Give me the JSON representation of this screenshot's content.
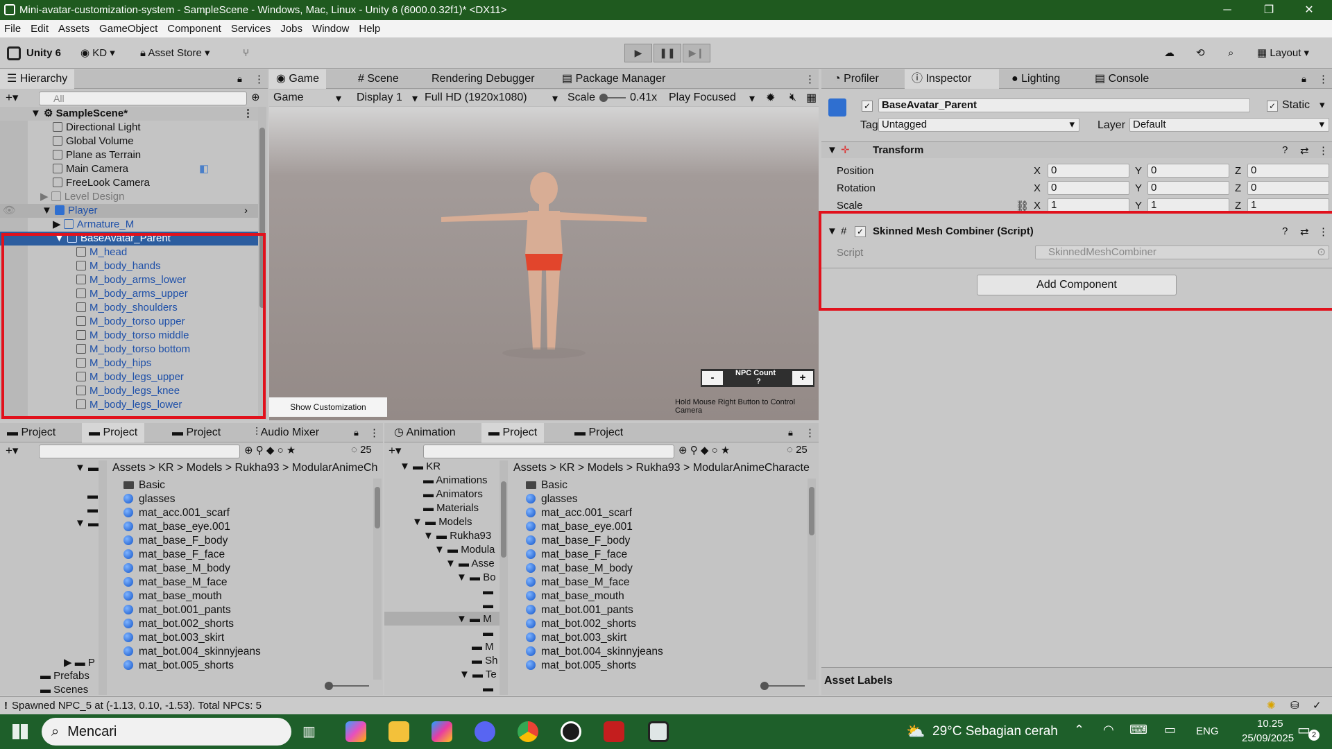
{
  "window": {
    "title": "Mini-avatar-customization-system - SampleScene - Windows, Mac, Linux - Unity 6 (6000.0.32f1)* <DX11>"
  },
  "menu": [
    "File",
    "Edit",
    "Assets",
    "GameObject",
    "Component",
    "Services",
    "Jobs",
    "Window",
    "Help"
  ],
  "toolbar": {
    "unity": "Unity 6",
    "account": "KD",
    "asset_store": "Asset Store",
    "layout": "Layout"
  },
  "hierarchy": {
    "tab": "Hierarchy",
    "search_placeholder": "All",
    "scene": "SampleScene*",
    "items": [
      "Directional Light",
      "Global Volume",
      "Plane as Terrain",
      "Main Camera",
      "FreeLook Camera",
      "Level Design",
      "Player",
      "Armature_M",
      "BaseAvatar_Parent",
      "M_head",
      "M_body_hands",
      "M_body_arms_lower",
      "M_body_arms_upper",
      "M_body_shoulders",
      "M_body_torso upper",
      "M_body_torso middle",
      "M_body_torso bottom",
      "M_body_hips",
      "M_body_legs_upper",
      "M_body_legs_knee",
      "M_body_legs_lower"
    ]
  },
  "game": {
    "tabs": [
      "Game",
      "Scene",
      "Rendering Debugger",
      "Package Manager"
    ],
    "game_dd": "Game",
    "display": "Display 1",
    "resolution": "Full HD (1920x1080)",
    "scale_label": "Scale",
    "scale_value": "0.41x",
    "play_focused": "Play Focused",
    "npc_label": "NPC Count",
    "npc_value": "?",
    "minus": "-",
    "plus": "+",
    "show_custom": "Show Customization",
    "hint": "Hold Mouse Right Button to Control Camera"
  },
  "inspector": {
    "tabs": [
      "Profiler",
      "Inspector",
      "Lighting",
      "Console"
    ],
    "object_name": "BaseAvatar_Parent",
    "static": "Static",
    "tag_label": "Tag",
    "tag": "Untagged",
    "layer_label": "Layer",
    "layer": "Default",
    "transform": "Transform",
    "rows": [
      {
        "label": "Position",
        "x": "0",
        "y": "0",
        "z": "0"
      },
      {
        "label": "Rotation",
        "x": "0",
        "y": "0",
        "z": "0"
      },
      {
        "label": "Scale",
        "x": "1",
        "y": "1",
        "z": "1"
      }
    ],
    "component": "Skinned Mesh Combiner (Script)",
    "script_label": "Script",
    "script_value": "SkinnedMeshCombiner",
    "add_component": "Add Component",
    "asset_labels": "Asset Labels"
  },
  "project_left": {
    "tabs": [
      "Project",
      "Project",
      "Project",
      "Audio Mixer"
    ],
    "count": "25",
    "breadcrumb": [
      "Assets",
      "KR",
      "Models",
      "Rukha93",
      "ModularAnimeCh"
    ],
    "tree": [
      "P",
      "Prefabs",
      "Scenes"
    ],
    "items": [
      "Basic",
      "glasses",
      "mat_acc.001_scarf",
      "mat_base_eye.001",
      "mat_base_F_body",
      "mat_base_F_face",
      "mat_base_M_body",
      "mat_base_M_face",
      "mat_base_mouth",
      "mat_bot.001_pants",
      "mat_bot.002_shorts",
      "mat_bot.003_skirt",
      "mat_bot.004_skinnyjeans",
      "mat_bot.005_shorts"
    ]
  },
  "project_right": {
    "tabs": [
      "Animation",
      "Project",
      "Project"
    ],
    "count": "25",
    "breadcrumb": [
      "Assets",
      "KR",
      "Models",
      "Rukha93",
      "ModularAnimeCharacte"
    ],
    "tree": [
      "KR",
      "Animations",
      "Animators",
      "Materials",
      "Models",
      "Rukha93",
      "Modula",
      "Asse",
      "Bo",
      "M",
      "M",
      "Sh",
      "Te"
    ],
    "items": [
      "Basic",
      "glasses",
      "mat_acc.001_scarf",
      "mat_base_eye.001",
      "mat_base_F_body",
      "mat_base_F_face",
      "mat_base_M_body",
      "mat_base_M_face",
      "mat_base_mouth",
      "mat_bot.001_pants",
      "mat_bot.002_shorts",
      "mat_bot.003_skirt",
      "mat_bot.004_skinnyjeans",
      "mat_bot.005_shorts"
    ]
  },
  "status": {
    "text": "Spawned NPC_5 at (-1.13, 0.10, -1.53). Total NPCs: 5"
  },
  "taskbar": {
    "search": "Mencari",
    "weather": "29°C Sebagian cerah",
    "lang": "ENG",
    "time": "10.25",
    "date": "25/09/2025",
    "notif": "2"
  }
}
